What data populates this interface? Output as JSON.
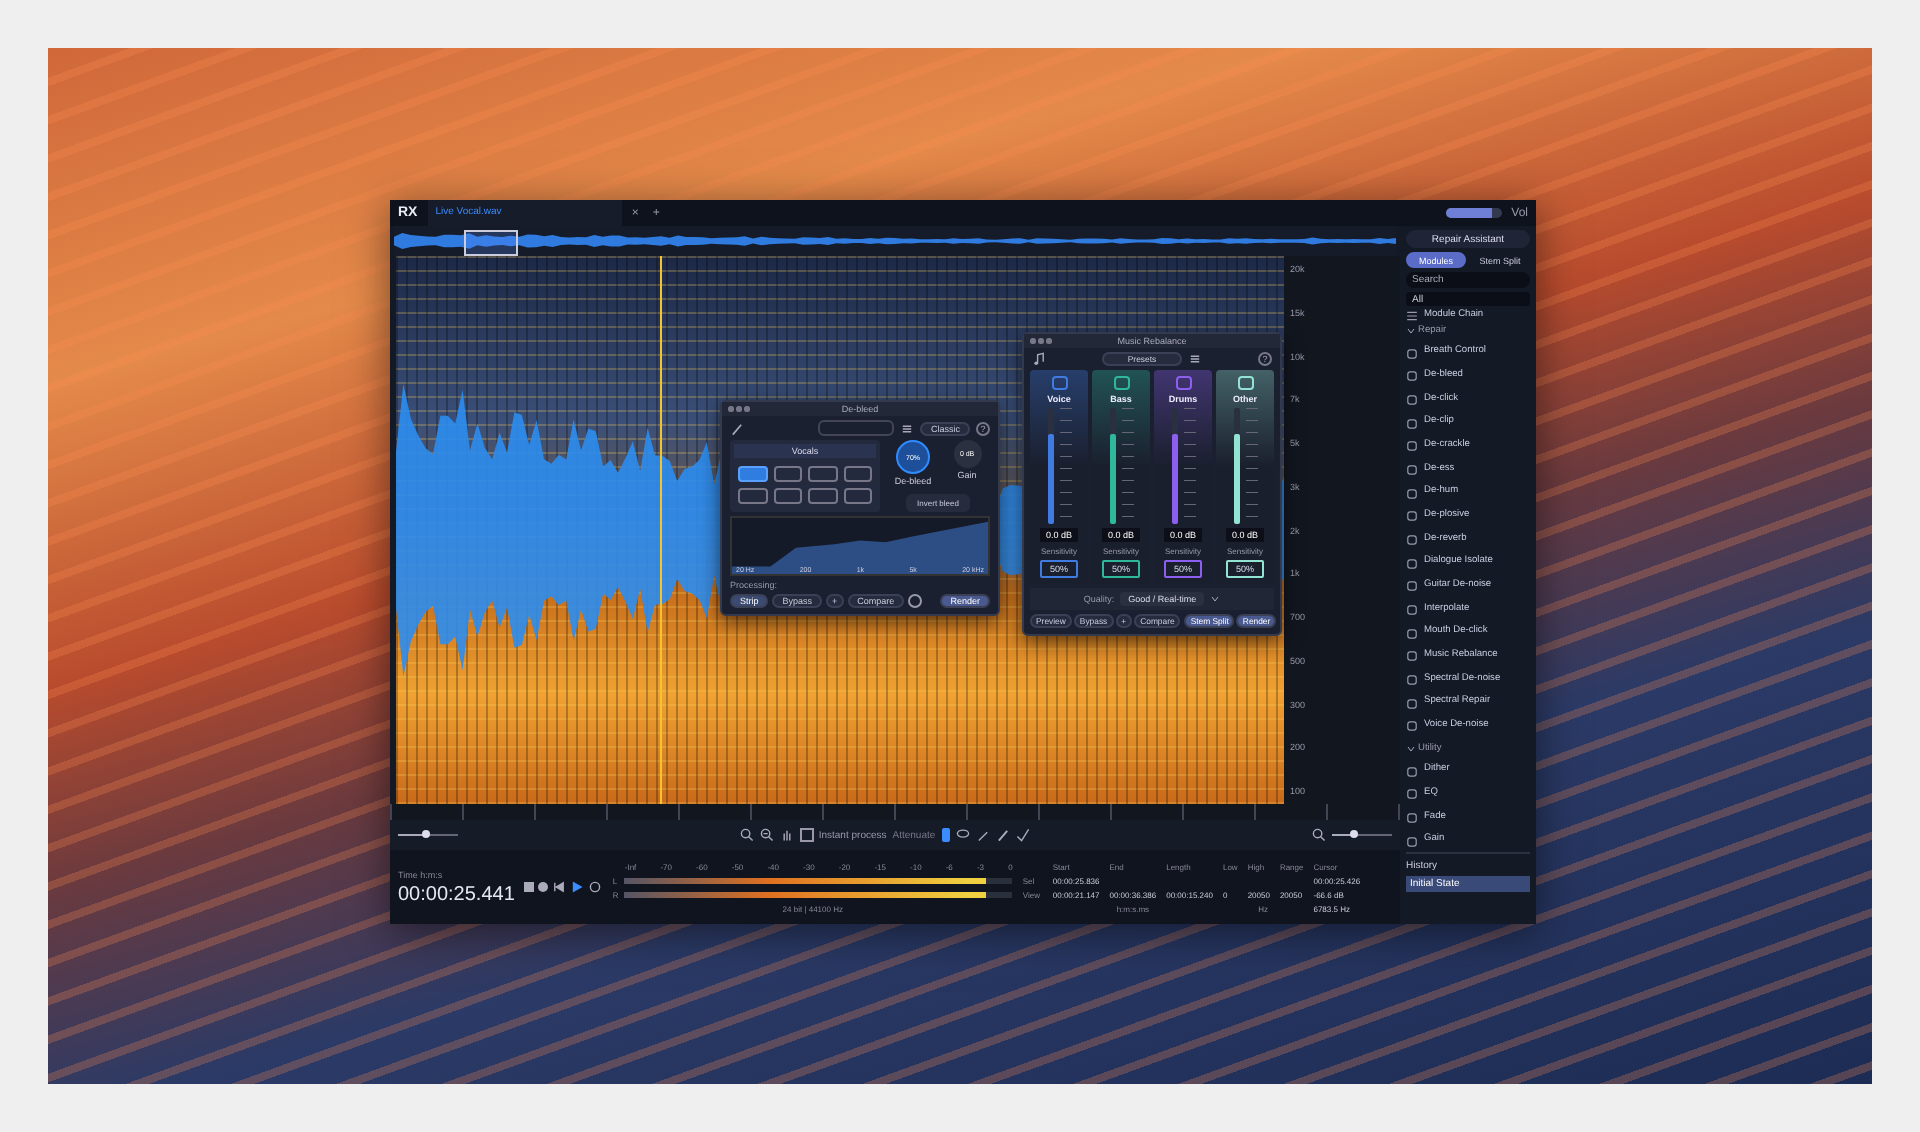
{
  "app": {
    "logo": "RX",
    "file_tab": "Live Vocal.wav",
    "close": "×",
    "new_tab": "+",
    "volume_label": "Vol",
    "volume": {
      "level": 0.85
    }
  },
  "overview": {
    "repair_assistant": "Repair Assistant"
  },
  "frequency_ruler": [
    "20k",
    "15k",
    "10k",
    "7k",
    "5k",
    "3k",
    "2k",
    "1k",
    "700",
    "500",
    "300",
    "200",
    "100"
  ],
  "debleed": {
    "title": "De-bleed",
    "preset_button": "Classic",
    "help": "?",
    "category": "Vocals",
    "instruments": [
      {
        "selected": true
      },
      {
        "selected": false
      },
      {
        "selected": false
      },
      {
        "selected": false
      },
      {
        "selected": false
      },
      {
        "selected": false
      },
      {
        "selected": false
      },
      {
        "selected": false
      }
    ],
    "amount": {
      "value": "70%",
      "label": "De-bleed"
    },
    "gain": {
      "value": "0 dB",
      "label": "Gain"
    },
    "invert_button": "Invert bleed",
    "graph_labels": [
      "20 Hz",
      "200",
      "1k",
      "5k",
      "20 kHz"
    ],
    "processing_label": "Processing:",
    "buttons": [
      {
        "label": "Strip",
        "selected": true
      },
      {
        "label": "Bypass",
        "selected": false
      },
      {
        "label": "Compare",
        "selected": false
      }
    ],
    "plus": "+",
    "render": "Render"
  },
  "rebalance": {
    "title": "Music Rebalance",
    "presets": "Presets",
    "help": "?",
    "channels": [
      {
        "name": "Voice",
        "color": "#3f7be0",
        "level": 0.78,
        "gain": "0.0 dB",
        "sensitivity_label": "Sensitivity",
        "sensitivity": "50%"
      },
      {
        "name": "Bass",
        "color": "#2fb89c",
        "level": 0.78,
        "gain": "0.0 dB",
        "sensitivity_label": "Sensitivity",
        "sensitivity": "50%"
      },
      {
        "name": "Drums",
        "color": "#8d5ff0",
        "level": 0.78,
        "gain": "0.0 dB",
        "sensitivity_label": "Sensitivity",
        "sensitivity": "50%"
      },
      {
        "name": "Other",
        "color": "#93e3d3",
        "level": 0.78,
        "gain": "0.0 dB",
        "sensitivity_label": "Sensitivity",
        "sensitivity": "50%"
      }
    ],
    "quality_label": "Quality:",
    "quality": "Good / Real-time",
    "buttons": [
      {
        "label": "Preview",
        "selected": false
      },
      {
        "label": "Bypass",
        "selected": false
      },
      {
        "label": "Compare",
        "selected": false
      }
    ],
    "plus": "+",
    "stem_split": "Stem Split",
    "render": "Render"
  },
  "toolbar": {
    "zoom_left": {
      "level": 0.45
    },
    "zoom_right": {
      "level": 0.35
    },
    "instant_process": {
      "label": "Instant process",
      "checked": false
    },
    "mode": "Attenuate"
  },
  "transport": {
    "time_format": "Time h:m:s",
    "time": "00:00:25.441",
    "meter": {
      "ticks": [
        "-Inf",
        "-70",
        "-60",
        "-50",
        "-40",
        "-30",
        "-20",
        "-15",
        "-10",
        "-6",
        "-3",
        "0"
      ],
      "channels": [
        {
          "name": "L",
          "level": 0.93
        },
        {
          "name": "R",
          "level": 0.93
        }
      ],
      "format": "24 bit | 44100 Hz"
    }
  },
  "selection": {
    "columns": [
      "Start",
      "End",
      "Length",
      "Low",
      "High",
      "Range"
    ],
    "rows": [
      {
        "label": "Sel",
        "cells": [
          "00:00:25.836",
          null,
          null,
          null,
          null,
          null
        ]
      },
      {
        "label": "View",
        "cells": [
          "00:00:21.147",
          "00:00:36.386",
          "00:00:15.240",
          "0",
          "20050",
          "20050"
        ]
      }
    ],
    "units": [
      "h:m:s.ms",
      "Hz"
    ],
    "cursor_label": "Cursor",
    "cursor": [
      "00:00:25.426",
      "-66.6 dB",
      "6783.5 Hz"
    ]
  },
  "sidebar": {
    "tabs": [
      {
        "label": "Modules",
        "selected": true
      },
      {
        "label": "Stem Split",
        "selected": false
      }
    ],
    "search": {
      "placeholder": "Search"
    },
    "filter": "All",
    "module_chain": "Module Chain",
    "groups": [
      {
        "title": "Repair",
        "expanded": true,
        "items": [
          "Breath Control",
          "De-bleed",
          "De-click",
          "De-clip",
          "De-crackle",
          "De-ess",
          "De-hum",
          "De-plosive",
          "De-reverb",
          "Dialogue Isolate",
          "Guitar De-noise",
          "Interpolate",
          "Mouth De-click",
          "Music Rebalance",
          "Spectral De-noise",
          "Spectral Repair",
          "Voice De-noise"
        ]
      },
      {
        "title": "Utility",
        "expanded": true,
        "items": [
          "Dither",
          "EQ",
          "Fade",
          "Gain"
        ]
      }
    ]
  },
  "history": {
    "title": "History",
    "items": [
      {
        "label": "Initial State",
        "selected": true
      }
    ]
  }
}
